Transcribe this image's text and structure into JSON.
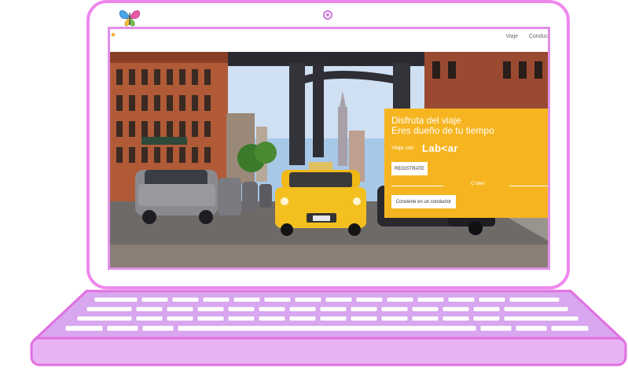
{
  "nav": {
    "items": [
      "Viaje",
      "Conduc"
    ]
  },
  "hero": {
    "title_line1": "Disfruta del viaje",
    "title_line2": "Eres dueño de tu tiempo",
    "with_label": "Viaja con",
    "brand": "Lab<ar",
    "register_button": "REGISTRATE",
    "or_text": "O bien",
    "driver_button": "Conviérte en un conductor"
  },
  "colors": {
    "accent_orange": "#f6b520",
    "laptop_pink": "#ee88ee",
    "keyboard_lilac": "#d9a6f0"
  }
}
